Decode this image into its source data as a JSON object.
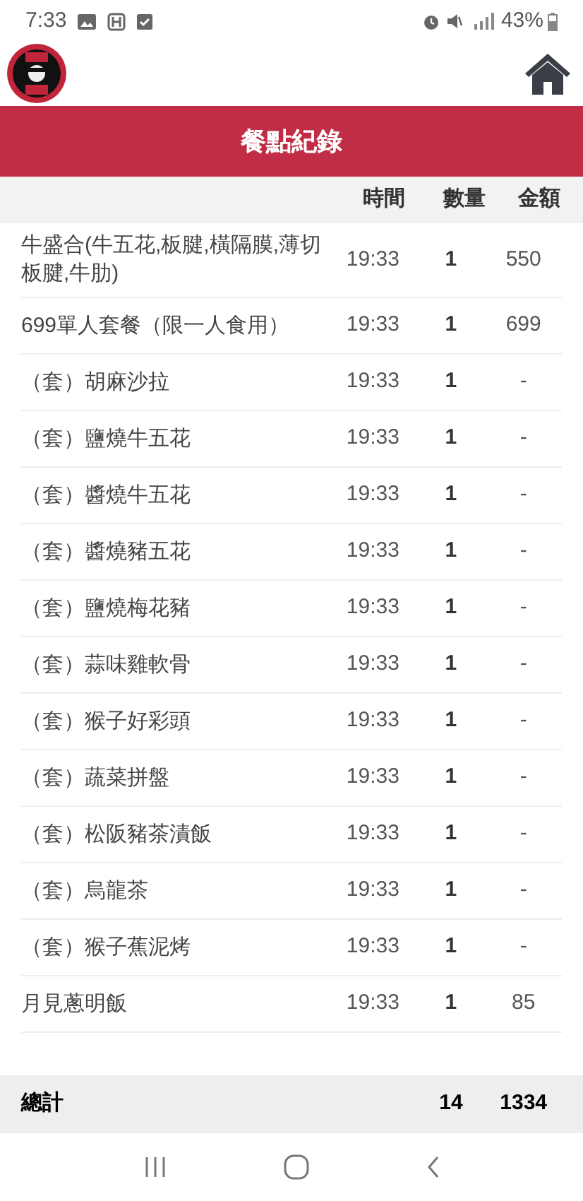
{
  "status_bar": {
    "time": "7:33",
    "battery": "43%"
  },
  "page_title": "餐點紀錄",
  "table": {
    "columns": [
      "時間",
      "數量",
      "金額"
    ],
    "rows": [
      {
        "name": "牛盛合(牛五花,板腱,橫隔膜,薄切板腱,牛肋)",
        "time": "19:33",
        "qty": "1",
        "amount": "550"
      },
      {
        "name": "699單人套餐（限一人食用）",
        "time": "19:33",
        "qty": "1",
        "amount": "699"
      },
      {
        "name": "（套）胡麻沙拉",
        "time": "19:33",
        "qty": "1",
        "amount": "-"
      },
      {
        "name": "（套）鹽燒牛五花",
        "time": "19:33",
        "qty": "1",
        "amount": "-"
      },
      {
        "name": "（套）醬燒牛五花",
        "time": "19:33",
        "qty": "1",
        "amount": "-"
      },
      {
        "name": "（套）醬燒豬五花",
        "time": "19:33",
        "qty": "1",
        "amount": "-"
      },
      {
        "name": "（套）鹽燒梅花豬",
        "time": "19:33",
        "qty": "1",
        "amount": "-"
      },
      {
        "name": "（套）蒜味雞軟骨",
        "time": "19:33",
        "qty": "1",
        "amount": "-"
      },
      {
        "name": "（套）猴子好彩頭",
        "time": "19:33",
        "qty": "1",
        "amount": "-"
      },
      {
        "name": "（套）蔬菜拼盤",
        "time": "19:33",
        "qty": "1",
        "amount": "-"
      },
      {
        "name": "（套）松阪豬茶漬飯",
        "time": "19:33",
        "qty": "1",
        "amount": "-"
      },
      {
        "name": "（套）烏龍茶",
        "time": "19:33",
        "qty": "1",
        "amount": "-"
      },
      {
        "name": "（套）猴子蕉泥烤",
        "time": "19:33",
        "qty": "1",
        "amount": "-"
      },
      {
        "name": "月見蔥明飯",
        "time": "19:33",
        "qty": "1",
        "amount": "85"
      }
    ],
    "total": {
      "label": "總計",
      "qty": "14",
      "amount": "1334"
    }
  }
}
